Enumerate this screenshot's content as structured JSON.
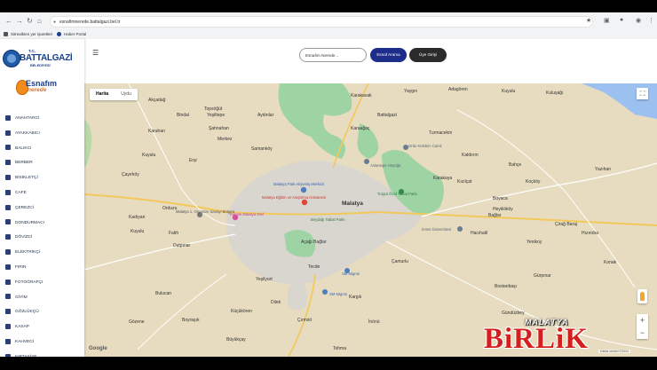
{
  "browser": {
    "url": "esnafimnerede.battalgazi.bel.tr",
    "nav_icons": [
      "back-icon",
      "forward-icon",
      "reload-icon",
      "home-icon"
    ],
    "bookmarks": [
      {
        "label": "Sitrealkten yer işaretleri",
        "icon": "folder-icon"
      },
      {
        "label": "Haber Portal",
        "icon": "globe-icon"
      }
    ]
  },
  "logo": {
    "tc": "T.C.",
    "name": "BATTALGAZİ",
    "sub": "BELEDİYESİ"
  },
  "brand": {
    "line1": "Esnafım",
    "line2": "nerede"
  },
  "menu": [
    {
      "label": "ANAHTARCI",
      "icon": "key-icon"
    },
    {
      "label": "AYAKKABICI",
      "icon": "shoe-icon"
    },
    {
      "label": "BALIKCI",
      "icon": "fish-icon"
    },
    {
      "label": "BERBER",
      "icon": "scissors-icon"
    },
    {
      "label": "BİSİKLETÇİ",
      "icon": "bicycle-icon"
    },
    {
      "label": "CAFE",
      "icon": "coffee-icon"
    },
    {
      "label": "ÇEREZCİ",
      "icon": "nut-icon"
    },
    {
      "label": "DONDURMACI",
      "icon": "ice-cream-icon"
    },
    {
      "label": "DÖVİZCİ",
      "icon": "currency-icon"
    },
    {
      "label": "ELEKTRİKÇİ",
      "icon": "plug-icon"
    },
    {
      "label": "FIRIN",
      "icon": "bread-icon"
    },
    {
      "label": "FOTOĞRAFÇI",
      "icon": "camera-icon"
    },
    {
      "label": "GİYİM",
      "icon": "shirt-icon"
    },
    {
      "label": "GÖZLÜKÇÜ",
      "icon": "glasses-icon"
    },
    {
      "label": "KASAP",
      "icon": "meat-icon"
    },
    {
      "label": "KAHVECİ",
      "icon": "cup-icon"
    },
    {
      "label": "KIRTASİYE",
      "icon": "pencil-icon"
    }
  ],
  "topbar": {
    "search_placeholder": "Esnafım Nerede...",
    "search_button": "Esnaf Arama",
    "login_button": "Üye Girişi"
  },
  "map": {
    "tabs": [
      "Harita",
      "Uydu"
    ],
    "active_tab": "Harita",
    "google": "Google",
    "attribution": "Harita verileri ©2024",
    "city_label": "Malatya",
    "places": [
      {
        "name": "Akçadağ"
      },
      {
        "name": "Bindal"
      },
      {
        "name": "Topsöğüt"
      },
      {
        "name": "Yeşiltepe"
      },
      {
        "name": "Aydınlar"
      },
      {
        "name": "Battalgazi"
      },
      {
        "name": "Karakavak"
      },
      {
        "name": "Yaygın"
      },
      {
        "name": "Adagören"
      },
      {
        "name": "Kuluşağı"
      },
      {
        "name": "Kuyulu"
      },
      {
        "name": "Karahan"
      },
      {
        "name": "Samanköy"
      },
      {
        "name": "Merkez"
      },
      {
        "name": "Erşi"
      },
      {
        "name": "Çayırköy"
      },
      {
        "name": "Kuyulu"
      },
      {
        "name": "Turmacekm"
      },
      {
        "name": "Karaağaç"
      },
      {
        "name": "Karakaya"
      },
      {
        "name": "Kaldırım"
      },
      {
        "name": "Kızılçat"
      },
      {
        "name": "Şahnahan"
      },
      {
        "name": "Koçköy"
      },
      {
        "name": "Heyiklıköy"
      },
      {
        "name": "Boyaca"
      },
      {
        "name": "Bağlar"
      },
      {
        "name": "Hacıhalil"
      },
      {
        "name": "Hızıroba"
      },
      {
        "name": "Çirağ Baraj"
      },
      {
        "name": "Yenikoy"
      },
      {
        "name": "Bahçe"
      },
      {
        "name": "Yazıhan"
      },
      {
        "name": "Kuyulu"
      },
      {
        "name": "Fatih"
      },
      {
        "name": "Dutpınar"
      },
      {
        "name": "Kadıyan"
      },
      {
        "name": "Orduzu"
      },
      {
        "name": "Açağı Bağlar"
      },
      {
        "name": "Çamurlu"
      },
      {
        "name": "Tecde"
      },
      {
        "name": "Yeşilyurt"
      },
      {
        "name": "Dilek"
      },
      {
        "name": "Çırmıkt"
      },
      {
        "name": "Küçükören"
      },
      {
        "name": "Kargılı"
      },
      {
        "name": "Gürpınar"
      },
      {
        "name": "Bostanbaşı"
      },
      {
        "name": "Konak"
      },
      {
        "name": "Bulucan"
      },
      {
        "name": "Gündüzbey"
      },
      {
        "name": "Boyraşık"
      },
      {
        "name": "Büyükçay"
      },
      {
        "name": "İnönü"
      },
      {
        "name": "Gözene"
      },
      {
        "name": "Tohma"
      }
    ],
    "pois": [
      {
        "name": "Malatya Park Alışveriş Merkezi"
      },
      {
        "name": "Malatya Eğitim ve Araştırma Hastanesi"
      },
      {
        "name": "Turgut Özal Tabiat Parkı"
      },
      {
        "name": "Beydağı Tabiat Parkı"
      },
      {
        "name": "Kernek Malatya Otel"
      },
      {
        "name": "Malatya 1. Organize Sanayi Bölgesi"
      },
      {
        "name": "SM Migros"
      },
      {
        "name": "SM Migros"
      },
      {
        "name": "İnönü Üniversitesi"
      },
      {
        "name": "Ordu Kelebim Camii"
      },
      {
        "name": "Aslantepe Höyüğü"
      }
    ]
  },
  "watermark": {
    "top": "MALATYA",
    "main": "BiRLiK"
  },
  "colors": {
    "primary_button": "#1d2d8a",
    "secondary_button": "#2b2b2b",
    "brand_orange": "#e8731a",
    "brand_blue": "#1b3f8b",
    "watermark_red": "#d51f1f",
    "map_land": "#e7dcc0",
    "map_urban": "#d9d5cf",
    "map_park": "#9ed3a4"
  }
}
